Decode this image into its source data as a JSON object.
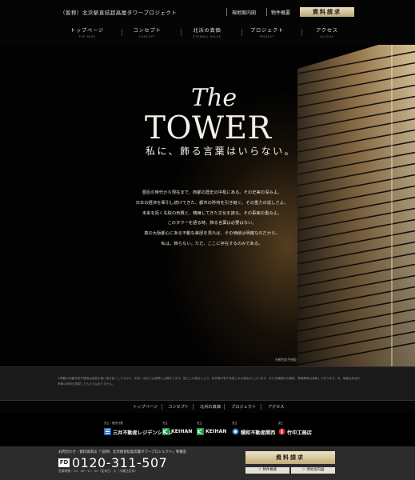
{
  "header": {
    "site_title": "（仮称）北浜駅直結超高層タワープロジェクト",
    "links": {
      "map": "現地案内図",
      "outline": "物件概要"
    },
    "request_button": "資料請求"
  },
  "global_nav": [
    {
      "jp": "トップページ",
      "en": "TOP PAGE"
    },
    {
      "jp": "コンセプト",
      "en": "CONCEPT"
    },
    {
      "jp": "北浜の真価",
      "en": "ETERNAL VALUE"
    },
    {
      "jp": "プロジェクト",
      "en": "PROJECT"
    },
    {
      "jp": "アクセス",
      "en": "ACCESS"
    }
  ],
  "hero": {
    "logo_the": "The",
    "logo_tower": "TOWER",
    "copy": "私に、飾る言葉はいらない。",
    "poem": [
      "豊臣の時代から現在まで、商都の歴史の中枢にある。その史実の深みよ。",
      "日本の経済を牽引し続けてきた、都市の矜持を引き継ぐ。その重力の逞しさよ。",
      "未来を拓く先取の気概と、精練してきた文化を誇る。その事実の重みよ。",
      "このタワーを語る時、飾る言葉は必要はない。",
      "真の大阪都心にある不動な美邸を見れば、その価値は明確なのだから。",
      "私は、飾らない。ただ、ここに存在するのみである。"
    ],
    "caption": "外観完成予想図"
  },
  "disclaimer": "※掲載の外観完成予想図は図面を基に描き起こしたもので、形状・色などは実際とは異なります。施工上の都合により、形状等が若干変更となる場合がございます。また外観周辺の植栽、電線類等は省略してあります。尚、植栽は特定の季節の状態を表現したものではありません。",
  "footer_nav": [
    "トップページ",
    "コンセプト",
    "北浜の真価",
    "プロジェクト",
    "アクセス"
  ],
  "companies": [
    {
      "role": "売主・販売代理",
      "name": "三井不動産レジデンシャル",
      "color": "#1e6bc4"
    },
    {
      "role": "売主",
      "name": "KEIHAN",
      "sub": "京阪電気鉄道",
      "color": "#1f9a4a"
    },
    {
      "role": "売主",
      "name": "KEIHAN",
      "sub": "京阪建物",
      "color": "#1f9a4a"
    },
    {
      "role": "売主",
      "name": "積和不動産関西",
      "color": "#2a7cc9"
    },
    {
      "role": "施工",
      "name": "竹中工務店",
      "color": "#d42b2b"
    }
  ],
  "contact": {
    "note": "お問合わせ・資料請求は「（仮称）北浜駅直結超高層タワープロジェクト」準備室",
    "fd_label": "FD",
    "phone": "0120-311-507",
    "hours": "営業時間／10：00〜17：00（定休日：火・水曜日定休）",
    "request_button": "資料請求",
    "outline_button": "＞ 物件概要",
    "map_button": "＞ 現地案内図"
  }
}
